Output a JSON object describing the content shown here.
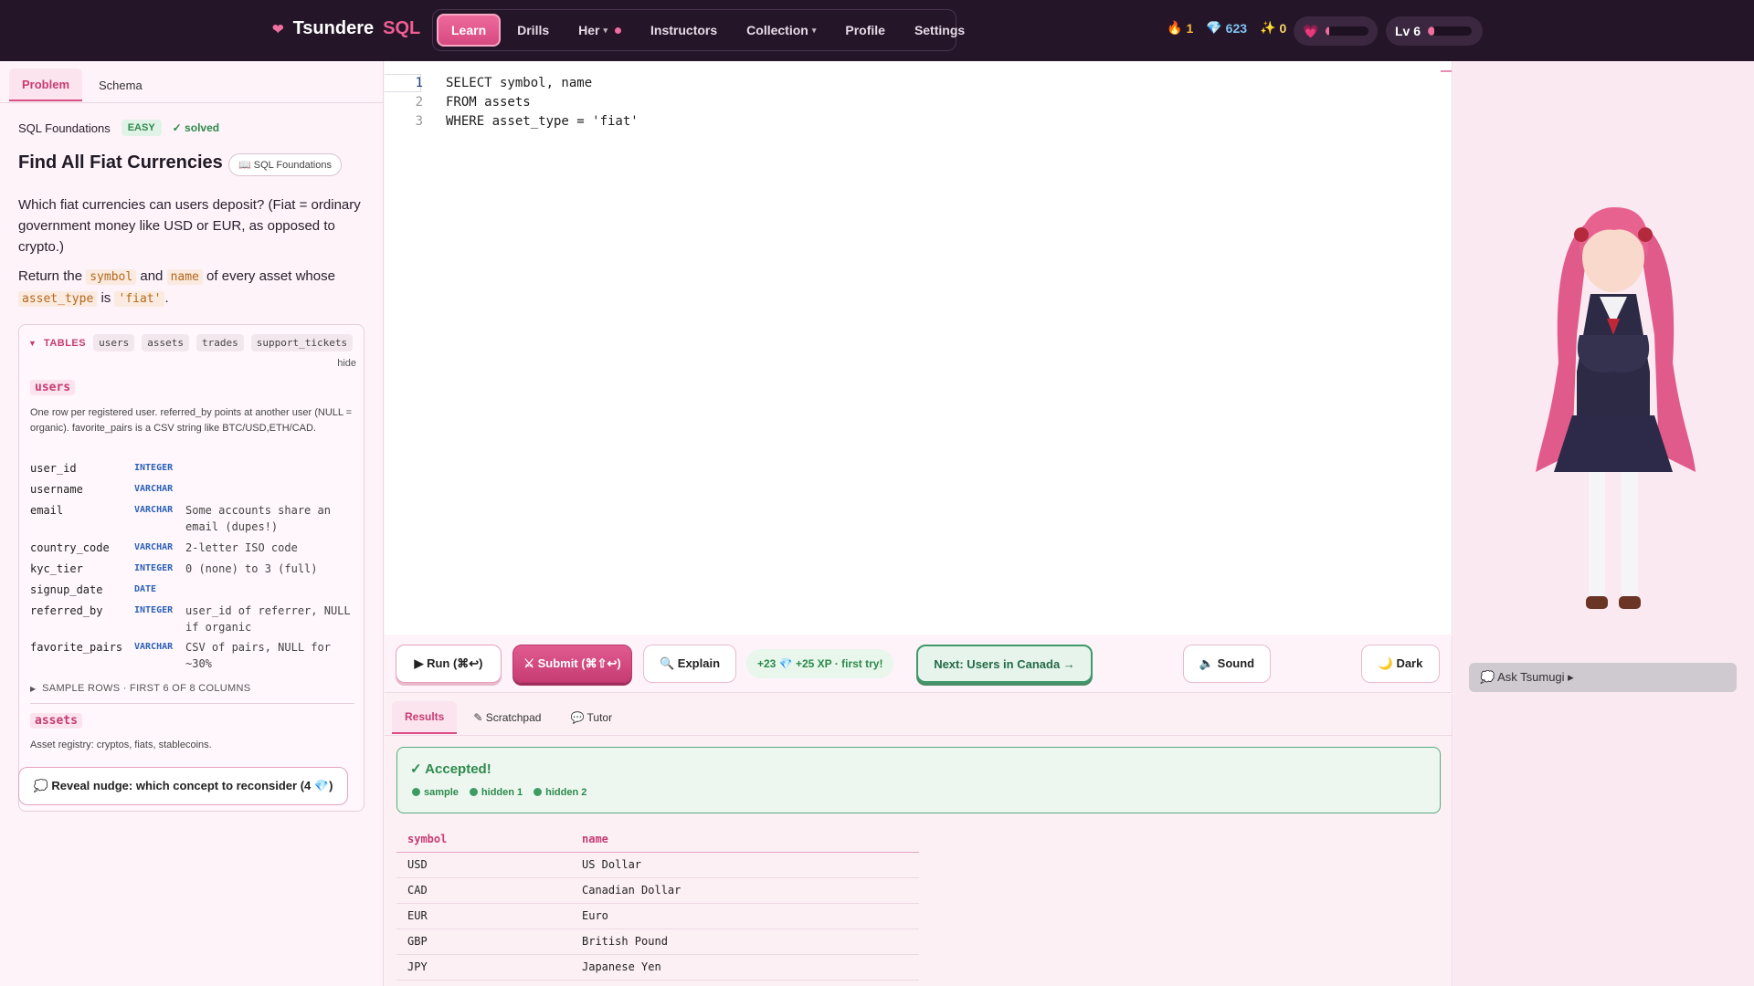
{
  "brand": {
    "name": "Tsundere",
    "accent": "SQL"
  },
  "nav": [
    {
      "label": "Learn",
      "active": true
    },
    {
      "label": "Drills"
    },
    {
      "label": "Her"
    },
    {
      "label": "Instructors"
    },
    {
      "label": "Collection"
    },
    {
      "label": "Profile"
    },
    {
      "label": "Settings"
    }
  ],
  "stats": {
    "streak_icon": "🔥",
    "streak": "1",
    "gems_icon": "💎",
    "gems": "623",
    "spark_icon": "✨",
    "sparks": "0"
  },
  "affection": {
    "icon": "💗",
    "progress": 0.08
  },
  "level": {
    "label": "Lv 6",
    "progress": 0.15
  },
  "left_tabs": [
    "Problem",
    "Schema"
  ],
  "problem": {
    "course": "SQL Foundations",
    "difficulty": "EASY",
    "status": "✓ solved",
    "title": "Find All Fiat Currencies",
    "chip": "📖 SQL Foundations",
    "para1": "Which fiat currencies can users deposit? (Fiat = ordinary government money like USD or EUR, as opposed to crypto.)",
    "para2_a": "Return the",
    "para2_symbol": "symbol",
    "para2_and": "and",
    "para2_name": "name",
    "para2_b": "of every asset whose",
    "para2_col": "asset_type",
    "para2_is": "is",
    "para2_val": "'fiat'",
    "para2_end": "."
  },
  "schema": {
    "header": "TABLES",
    "tables": [
      "users",
      "assets",
      "trades",
      "support_tickets"
    ],
    "hide": "hide",
    "users": {
      "name": "users",
      "desc": "One row per registered user. referred_by points at another user (NULL = organic). favorite_pairs is a CSV string like BTC/USD,ETH/CAD.",
      "columns": [
        {
          "name": "user_id",
          "type": "INTEGER",
          "desc": ""
        },
        {
          "name": "username",
          "type": "VARCHAR",
          "desc": ""
        },
        {
          "name": "email",
          "type": "VARCHAR",
          "desc": "Some accounts share an email (dupes!)"
        },
        {
          "name": "country_code",
          "type": "VARCHAR",
          "desc": "2-letter ISO code"
        },
        {
          "name": "kyc_tier",
          "type": "INTEGER",
          "desc": "0 (none) to 3 (full)"
        },
        {
          "name": "signup_date",
          "type": "DATE",
          "desc": ""
        },
        {
          "name": "referred_by",
          "type": "INTEGER",
          "desc": "user_id of referrer, NULL if organic"
        },
        {
          "name": "favorite_pairs",
          "type": "VARCHAR",
          "desc": "CSV of pairs, NULL for ~30%"
        }
      ],
      "sample": "SAMPLE ROWS · FIRST 6 OF 8 COLUMNS"
    },
    "assets": {
      "name": "assets",
      "desc": "Asset registry: cryptos, fiats, stablecoins."
    }
  },
  "nudge": "💭 Reveal nudge: which concept to reconsider (4 💎)",
  "editor": {
    "lines": [
      "SELECT symbol, name",
      "FROM assets",
      "WHERE asset_type = 'fiat'"
    ]
  },
  "toolbar": {
    "run": "▶ Run (⌘↩)",
    "submit": "⚔ Submit (⌘⇧↩)",
    "explain": "🔍 Explain",
    "reward": "+23 💎 +25 XP · first try!",
    "next": "Next: Users in Canada →",
    "sound": "🔈 Sound",
    "dark": "🌙 Dark"
  },
  "result_tabs": [
    "Results",
    "✎ Scratchpad",
    "💬 Tutor"
  ],
  "result": {
    "status": "✓ Accepted!",
    "tests": [
      "sample",
      "hidden 1",
      "hidden 2"
    ],
    "columns": [
      "symbol",
      "name"
    ],
    "rows": [
      [
        "USD",
        "US Dollar"
      ],
      [
        "CAD",
        "Canadian Dollar"
      ],
      [
        "EUR",
        "Euro"
      ],
      [
        "GBP",
        "British Pound"
      ],
      [
        "JPY",
        "Japanese Yen"
      ]
    ]
  },
  "companion": {
    "ask": "💭 Ask Tsumugi ▸"
  }
}
